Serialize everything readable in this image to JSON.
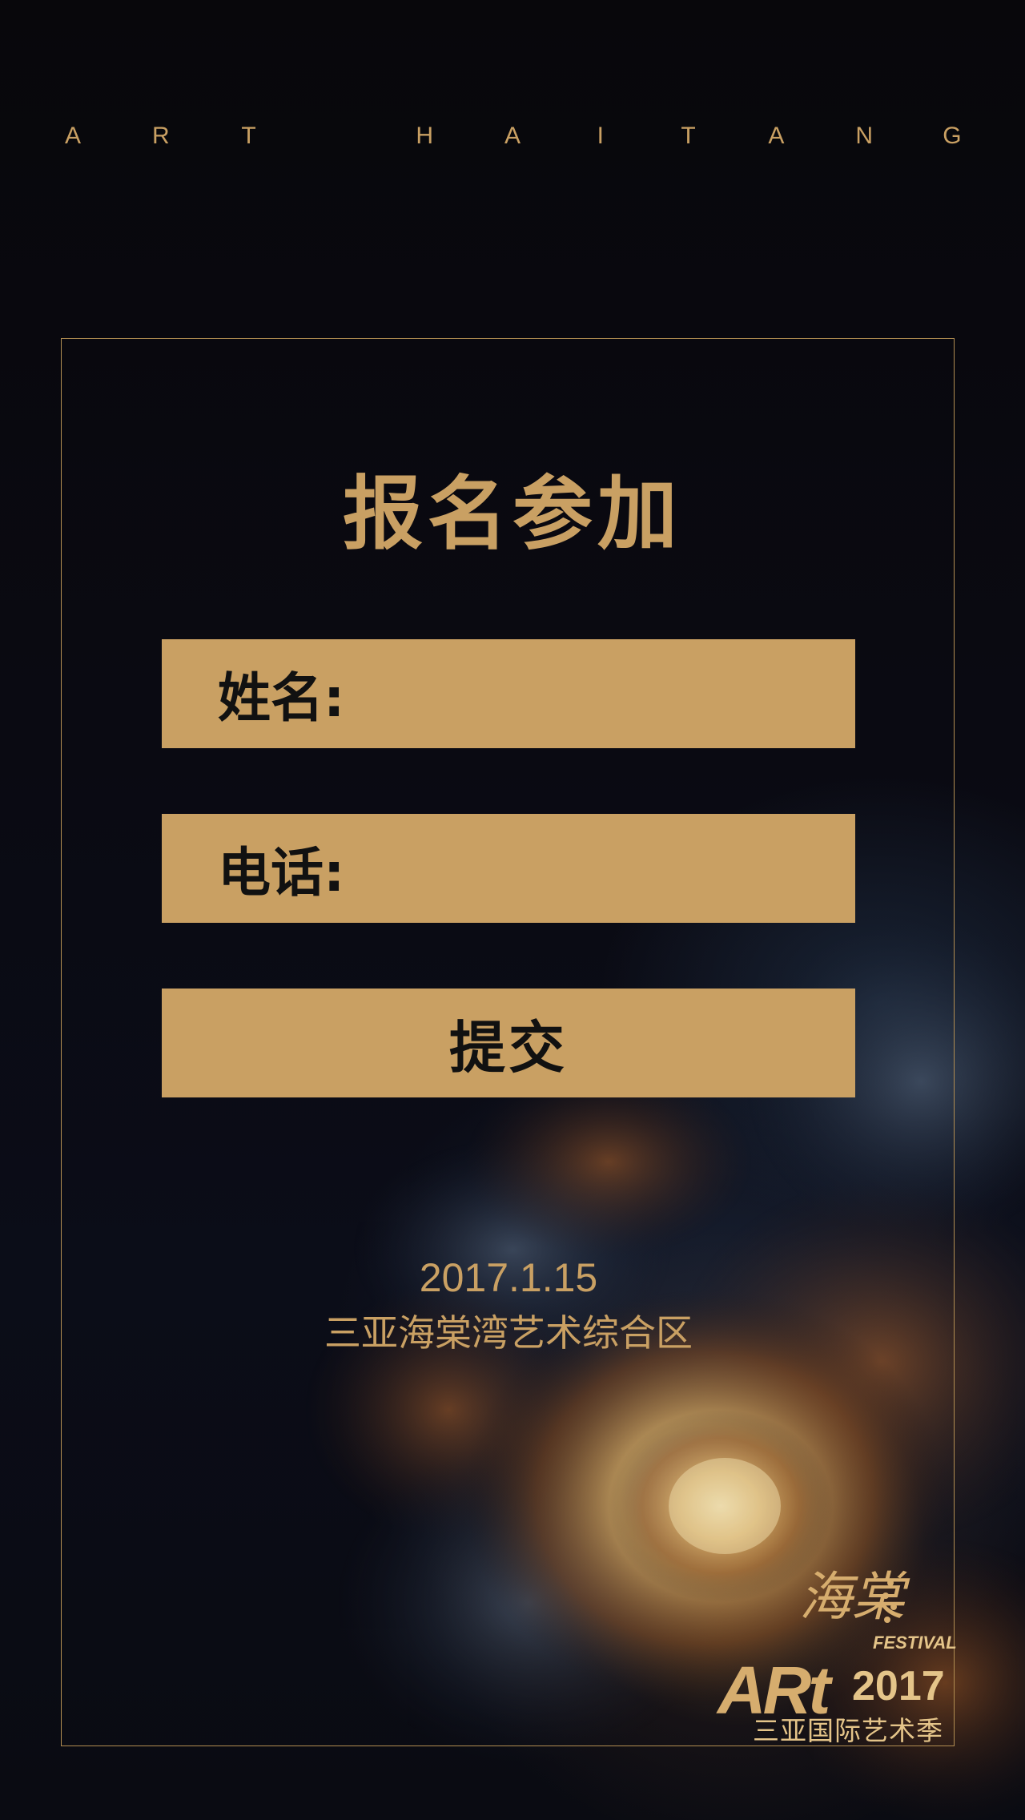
{
  "brand": {
    "letters": [
      "A",
      "R",
      "T",
      "",
      "H",
      "A",
      "I",
      "T",
      "A",
      "N",
      "G"
    ]
  },
  "form": {
    "title": "报名参加",
    "name_label": "姓名:",
    "phone_label": "电话:",
    "submit_label": "提交"
  },
  "event": {
    "date": "2017.1.15",
    "venue": "三亚海棠湾艺术综合区"
  },
  "logo": {
    "script": "海棠",
    "art": "ARt",
    "festival": "FESTIVAL",
    "year": "2017",
    "subtitle": "三亚国际艺术季"
  },
  "colors": {
    "gold": "#c9a063",
    "background": "#07060a",
    "text_dark": "#111111"
  }
}
